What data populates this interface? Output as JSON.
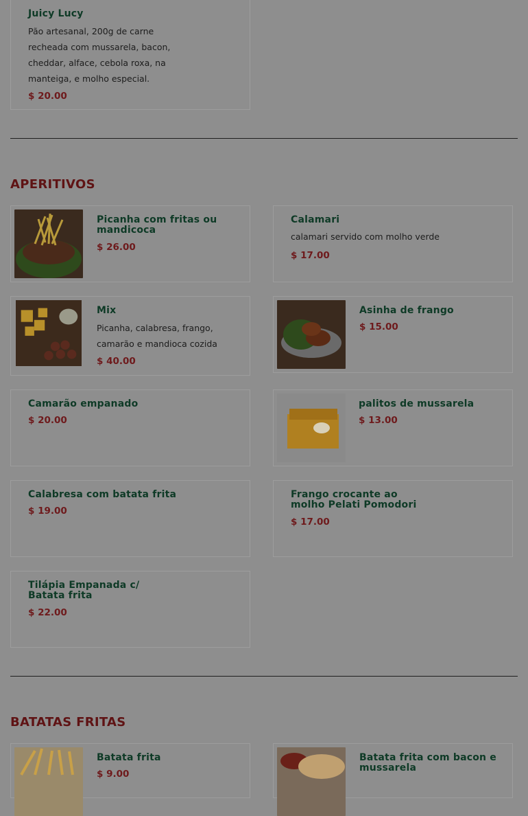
{
  "sections": [
    {
      "title": "",
      "items": [
        {
          "name": "Juicy Lucy",
          "description": "Pão artesanal, 200g de carne recheada com mussarela, bacon, cheddar, alface, cebola roxa, na manteiga, e molho especial.",
          "price": "$ 20.00",
          "image": null
        }
      ]
    },
    {
      "title": "APERITIVOS",
      "items": [
        {
          "name": "Picanha com fritas ou mandicoca",
          "description": "",
          "price": "$ 26.00",
          "image": "picanha-photo"
        },
        {
          "name": "Calamari",
          "description": "calamari servido com molho verde",
          "price": "$ 17.00",
          "image": null
        },
        {
          "name": "Mix",
          "description": "Picanha, calabresa, frango, camarão e mandioca cozida",
          "price": "$ 40.00",
          "image": "mix-photo"
        },
        {
          "name": "Asinha de frango",
          "description": "",
          "price": "$ 15.00",
          "image": "asinha-photo"
        },
        {
          "name": "Camarão empanado",
          "description": "",
          "price": "$ 20.00",
          "image": null
        },
        {
          "name": "palitos de mussarela",
          "description": "",
          "price": "$ 13.00",
          "image": "palitos-photo"
        },
        {
          "name": "Calabresa com batata frita",
          "description": "",
          "price": "$ 19.00",
          "image": null
        },
        {
          "name": "Frango crocante ao molho Pelati Pomodori",
          "description": "",
          "price": "$ 17.00",
          "image": null
        },
        {
          "name": "Tilápia Empanada c/ Batata frita",
          "description": "",
          "price": "$ 22.00",
          "image": null
        }
      ]
    },
    {
      "title": "BATATAS FRITAS",
      "items": [
        {
          "name": "Batata frita",
          "description": "",
          "price": "$ 9.00",
          "image": "batata-photo"
        },
        {
          "name": "Batata frita com bacon e mussarela",
          "description": "",
          "price": "",
          "image": "batata-bacon-photo"
        }
      ]
    }
  ],
  "colors": {
    "overlay_bg": "#8e8e8e",
    "title": "#0e3a26",
    "price": "#6e1a1c",
    "section": "#5f1314"
  }
}
